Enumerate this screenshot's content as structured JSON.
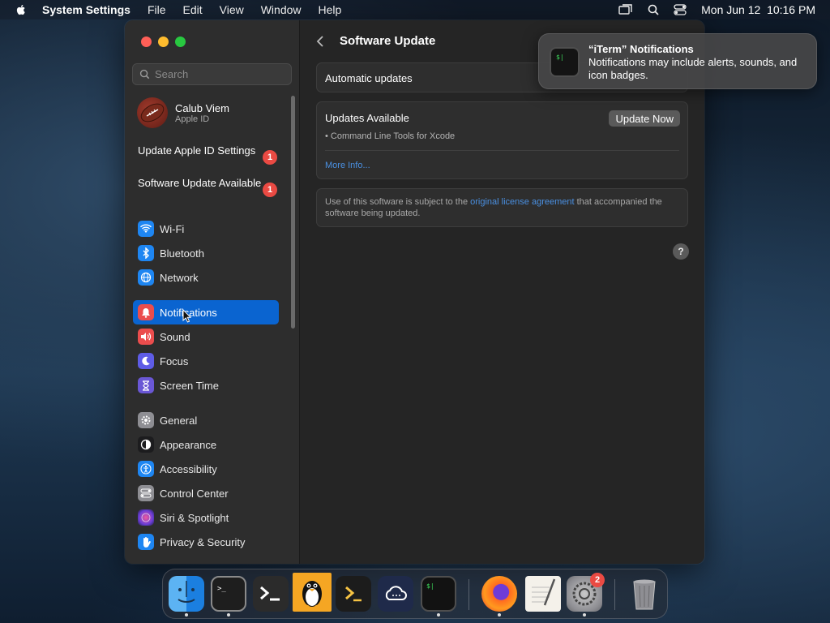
{
  "menubar": {
    "app_name": "System Settings",
    "items": [
      "File",
      "Edit",
      "View",
      "Window",
      "Help"
    ],
    "datetime": "Mon Jun 12  10:16 PM"
  },
  "sidebar": {
    "search_placeholder": "Search",
    "account": {
      "name": "Calub Viem",
      "subtitle": "Apple ID"
    },
    "alerts": [
      {
        "label": "Update Apple ID Settings",
        "badge": "1"
      },
      {
        "label": "Software Update Available",
        "badge": "1"
      }
    ],
    "items": [
      {
        "label": "Wi-Fi",
        "icon": "wifi-icon",
        "color": "#1e86f2"
      },
      {
        "label": "Bluetooth",
        "icon": "bluetooth-icon",
        "color": "#1e86f2"
      },
      {
        "label": "Network",
        "icon": "network-icon",
        "color": "#1e86f2"
      },
      {
        "label": "Notifications",
        "icon": "bell-icon",
        "color": "#eb4d4d",
        "selected": true
      },
      {
        "label": "Sound",
        "icon": "speaker-icon",
        "color": "#eb4d4d"
      },
      {
        "label": "Focus",
        "icon": "moon-icon",
        "color": "#5e5ce6"
      },
      {
        "label": "Screen Time",
        "icon": "hourglass-icon",
        "color": "#6a57d5"
      },
      {
        "label": "General",
        "icon": "gear-icon",
        "color": "#8e8e93"
      },
      {
        "label": "Appearance",
        "icon": "appearance-icon",
        "color": "#1c1c1e"
      },
      {
        "label": "Accessibility",
        "icon": "accessibility-icon",
        "color": "#1e86f2"
      },
      {
        "label": "Control Center",
        "icon": "control-center-icon",
        "color": "#8e8e93"
      },
      {
        "label": "Siri & Spotlight",
        "icon": "siri-icon",
        "color": "#c04fdb"
      },
      {
        "label": "Privacy & Security",
        "icon": "hand-icon",
        "color": "#1e86f2"
      }
    ]
  },
  "content": {
    "title": "Software Update",
    "automatic_updates_label": "Automatic updates",
    "updates": {
      "heading": "Updates Available",
      "button": "Update Now",
      "item": "• Command Line Tools for Xcode",
      "more_info": "More Info..."
    },
    "license": {
      "prefix": "Use of this software is subject to the ",
      "link": "original license agreement",
      "suffix": " that accompanied the software being updated."
    },
    "help": "?"
  },
  "notification": {
    "title": "“iTerm” Notifications",
    "body": "Notifications may include alerts, sounds, and icon badges."
  },
  "dock": {
    "apps": [
      {
        "name": "finder-icon"
      },
      {
        "name": "terminal-icon"
      },
      {
        "name": "iterm-icon"
      },
      {
        "name": "tux-icon"
      },
      {
        "name": "shell-icon"
      },
      {
        "name": "cloud-icon"
      },
      {
        "name": "iterm2-icon"
      },
      {
        "name": "firefox-icon"
      },
      {
        "name": "textedit-icon"
      },
      {
        "name": "system-settings-icon",
        "badge": "2"
      },
      {
        "name": "trash-icon"
      }
    ]
  }
}
